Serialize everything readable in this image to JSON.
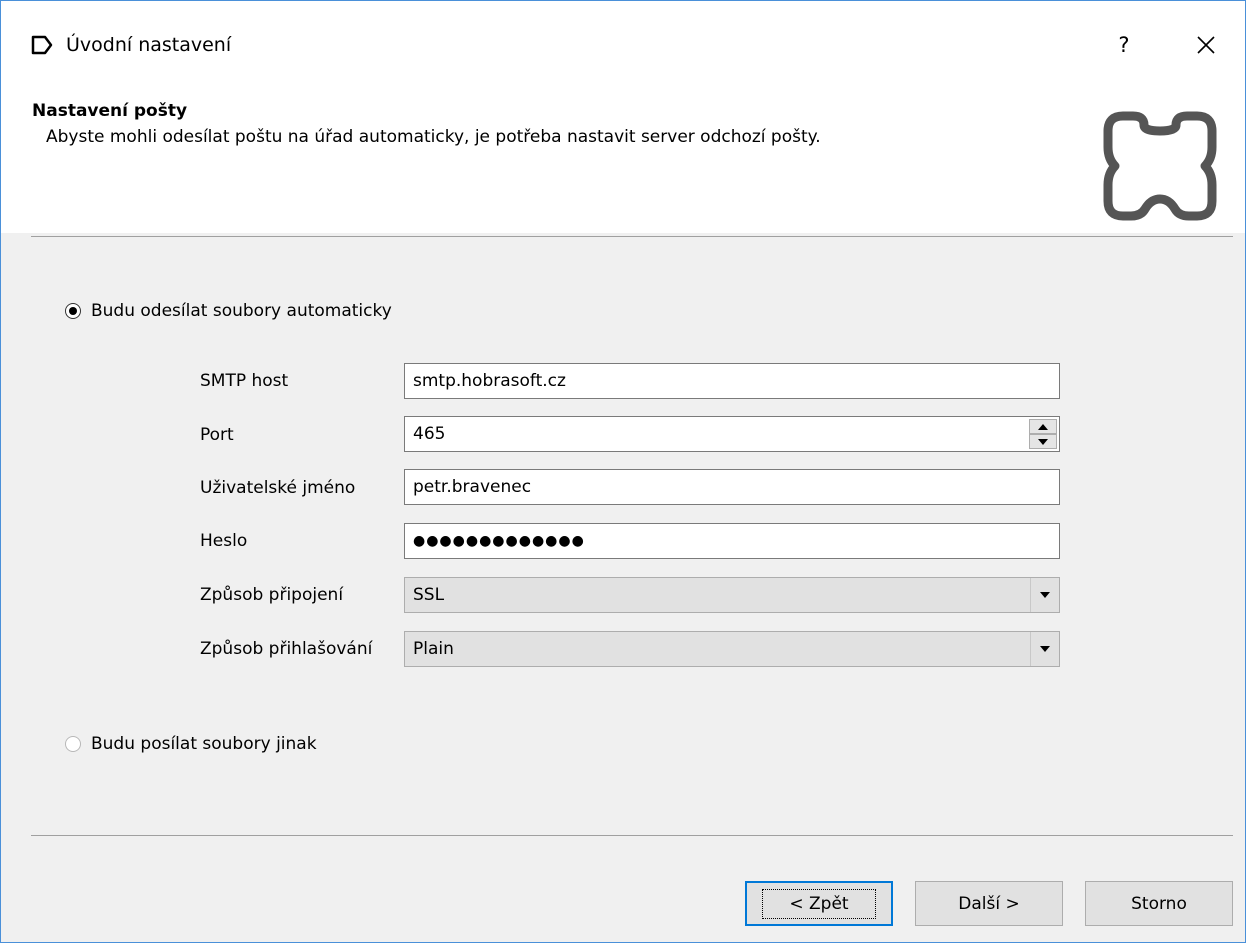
{
  "window": {
    "title": "Úvodní nastavení",
    "help_label": "?"
  },
  "header": {
    "title": "Nastavení pošty",
    "subtitle": "Abyste mohli odesílat poštu na úřad automaticky, je potřeba nastavit server odchozí pošty."
  },
  "options": {
    "auto": {
      "label": "Budu odesílat soubory automaticky",
      "checked": true
    },
    "other": {
      "label": "Budu posílat soubory jinak",
      "checked": false
    }
  },
  "form": {
    "smtp_host": {
      "label": "SMTP host",
      "value": "smtp.hobrasoft.cz"
    },
    "port": {
      "label": "Port",
      "value": "465"
    },
    "username": {
      "label": "Uživatelské jméno",
      "value": "petr.bravenec"
    },
    "password": {
      "label": "Heslo",
      "value": "●●●●●●●●●●●●●"
    },
    "connection": {
      "label": "Způsob připojení",
      "selected": "SSL"
    },
    "auth": {
      "label": "Způsob přihlašování",
      "selected": "Plain"
    }
  },
  "buttons": {
    "back": "< Zpět",
    "next": "Další >",
    "cancel": "Storno"
  },
  "colors": {
    "accent": "#0078d7",
    "window_border": "#4a90d9",
    "logo": "#555555"
  }
}
